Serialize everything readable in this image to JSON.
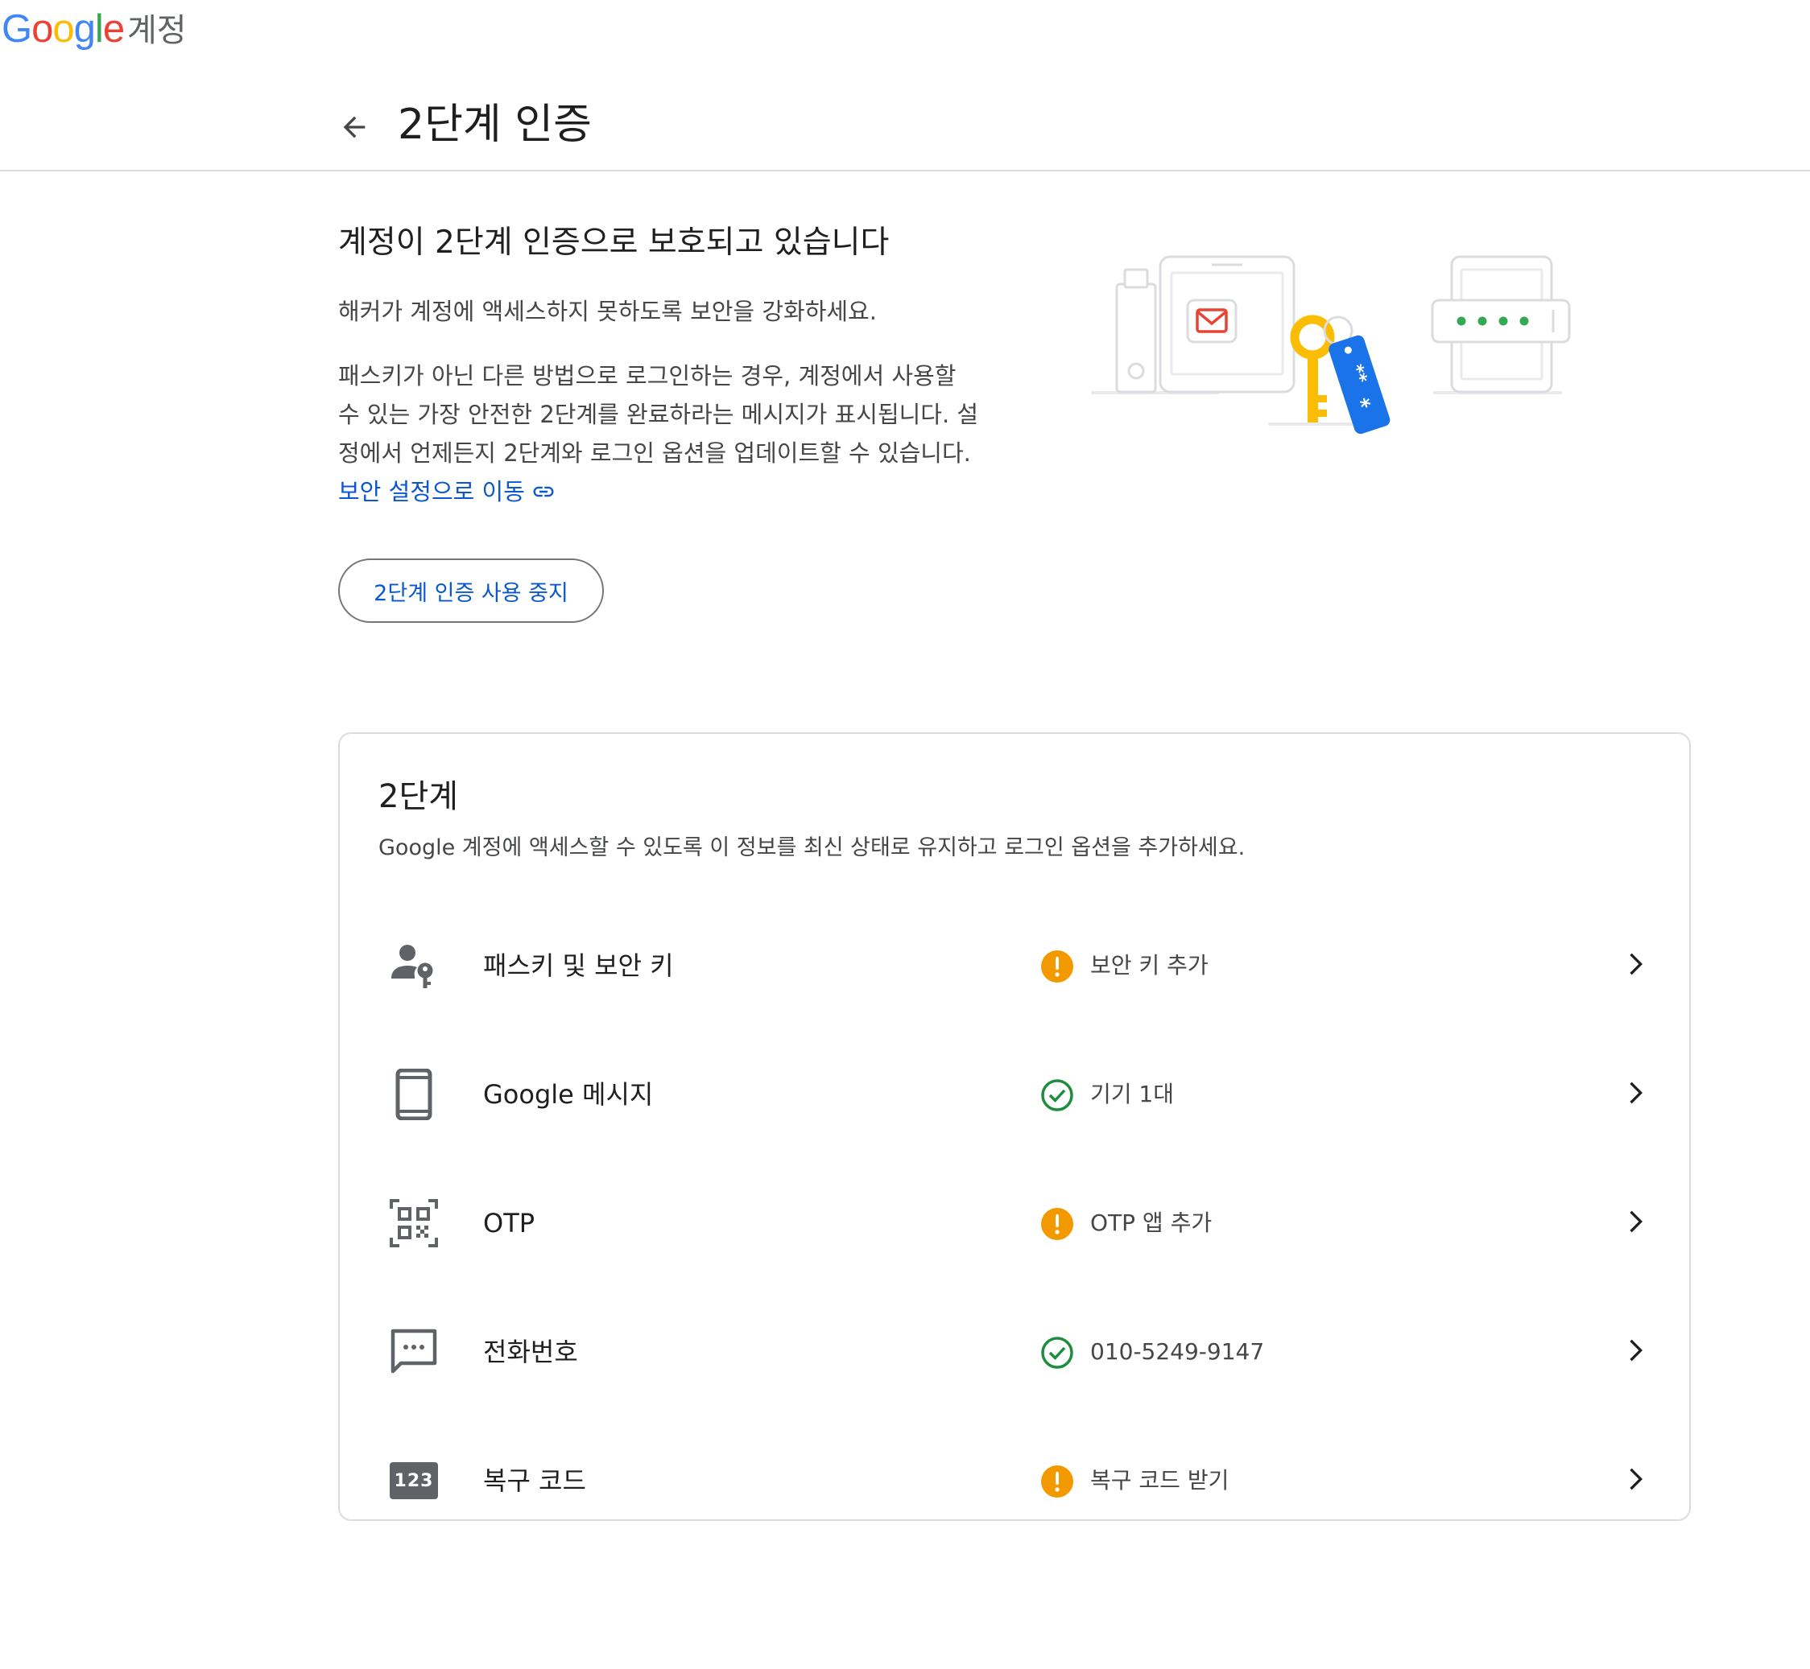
{
  "header": {
    "logo": {
      "letters": [
        "G",
        "o",
        "o",
        "g",
        "l",
        "e"
      ],
      "product": "계정"
    }
  },
  "page": {
    "title": "2단계 인증"
  },
  "intro": {
    "heading": "계정이 2단계 인증으로 보호되고 있습니다",
    "subtitle": "해커가 계정에 액세스하지 못하도록 보안을 강화하세요.",
    "paragraph_lines": [
      "패스키가 아닌 다른 방법으로 로그인하는 경우, 계정에서 사용할",
      "수 있는 가장 안전한 2단계를 완료하라는 메시지가 표시됩니다. 설",
      "정에서 언제든지 2단계와 로그인 옵션을 업데이트할 수 있습니다."
    ],
    "link": "보안 설정으로 이동",
    "turn_off_button": "2단계 인증 사용 중지"
  },
  "card": {
    "title": "2단계",
    "description": "Google 계정에 액세스할 수 있도록 이 정보를 최신 상태로 유지하고 로그인 옵션을 추가하세요.",
    "rows": [
      {
        "icon": "person-key-icon",
        "label": "패스키 및 보안 키",
        "status_type": "warning",
        "status": "보안 키 추가"
      },
      {
        "icon": "phone-icon",
        "label": "Google 메시지",
        "status_type": "ok",
        "status": "기기 1대"
      },
      {
        "icon": "qr-code-icon",
        "label": "OTP",
        "status_type": "warning",
        "status": "OTP 앱 추가"
      },
      {
        "icon": "message-icon",
        "label": "전화번호",
        "status_type": "ok",
        "status": "010-5249-9147"
      },
      {
        "icon": "recovery-code-icon",
        "icon_text": "123",
        "label": "복구 코드",
        "status_type": "warning",
        "status": "복구 코드 받기"
      }
    ]
  },
  "colors": {
    "link_blue": "#0b57d0",
    "warning": "#f29900",
    "ok": "#1e8e3e",
    "key_yellow": "#fbbc04",
    "tag_blue": "#1a73e8",
    "mail_red": "#ea4335",
    "dot_green": "#34a853"
  }
}
